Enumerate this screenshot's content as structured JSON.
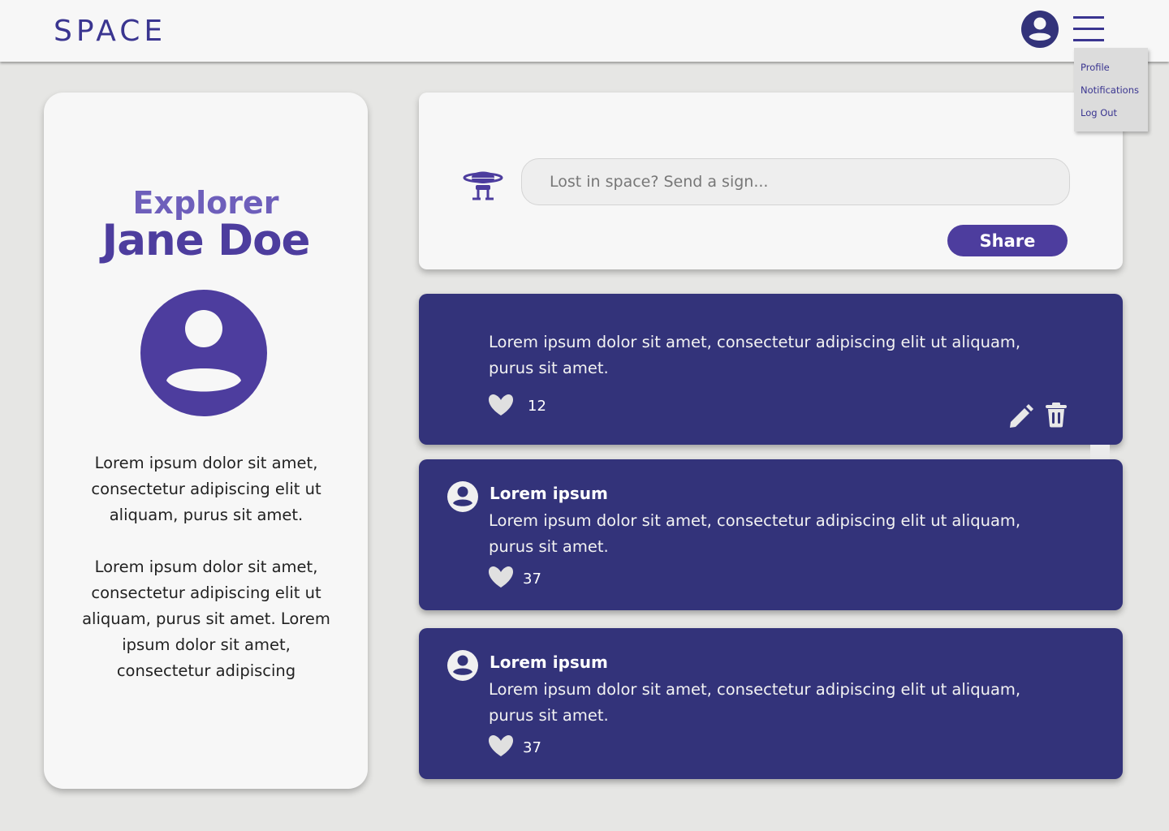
{
  "header": {
    "logo": "SPACE",
    "avatar_icon": "user-circle-icon",
    "menu_icon": "hamburger-menu-icon",
    "dropdown": [
      "Profile",
      "Notifications",
      "Log Out"
    ]
  },
  "profile": {
    "role": "Explorer",
    "name": "Jane Doe",
    "avatar_icon": "user-circle-icon",
    "bio": [
      "Lorem ipsum dolor sit amet, consectetur adipiscing elit ut aliquam, purus sit amet.",
      "Lorem ipsum dolor sit amet, consectetur adipiscing elit ut aliquam, purus sit amet. Lorem ipsum dolor sit amet, consectetur adipiscing"
    ]
  },
  "composer": {
    "icon": "planet-robot-icon",
    "placeholder": "Lost in space? Send a sign...",
    "share_label": "Share"
  },
  "posts": [
    {
      "author": "",
      "text": "Lorem ipsum dolor sit amet, consectetur adipiscing elit ut aliquam, purus sit amet.",
      "likes": "12",
      "editable": true
    },
    {
      "author": "Lorem ipsum",
      "text": "Lorem ipsum dolor sit amet, consectetur adipiscing elit ut aliquam, purus sit amet.",
      "likes": "37",
      "editable": false
    },
    {
      "author": "Lorem ipsum",
      "text": "Lorem ipsum dolor sit amet, consectetur adipiscing elit ut aliquam, purus sit amet.",
      "likes": "37",
      "editable": false
    }
  ],
  "colors": {
    "brand": "#3a3590",
    "accent": "#4d3d9e",
    "post_bg": "#33337a",
    "page_bg": "#e6e6e4"
  }
}
